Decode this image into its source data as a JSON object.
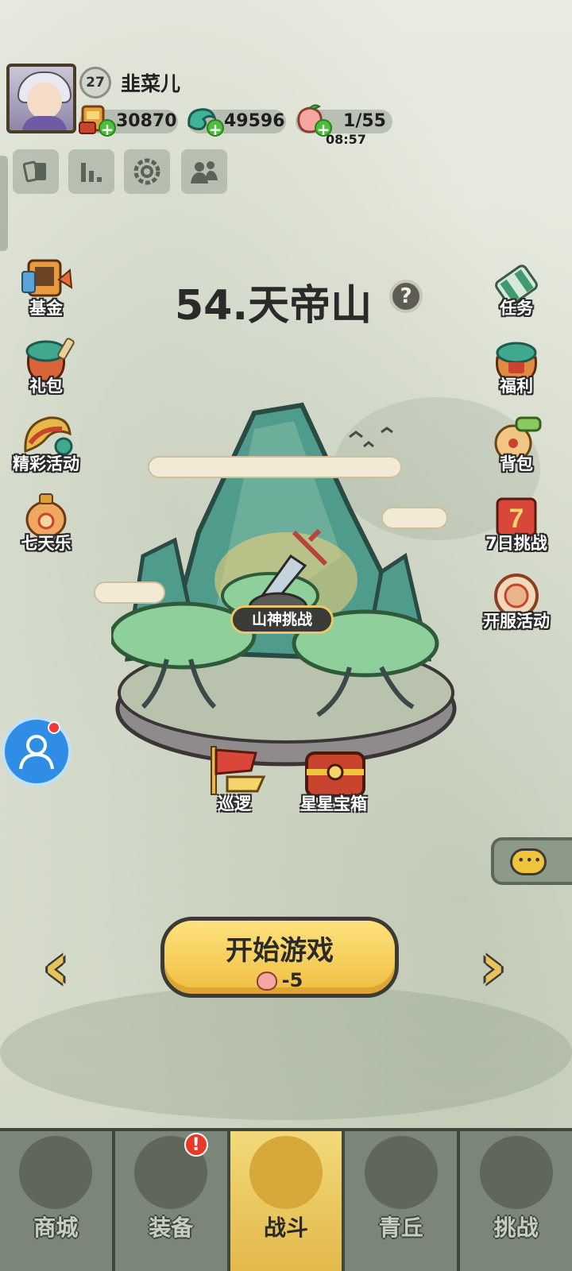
{
  "player": {
    "name": "韭菜儿",
    "level": "27"
  },
  "resources": {
    "gold": "30870",
    "gems": "49596",
    "stamina": "1/55",
    "stamina_timer": "08:57"
  },
  "toolbar": {
    "icons": [
      "card-icon",
      "stats-icon",
      "settings-icon",
      "friends-icon"
    ]
  },
  "left_menu": [
    {
      "label": "基金",
      "icon": "fund-icon"
    },
    {
      "label": "礼包",
      "icon": "gift-pack-icon"
    },
    {
      "label": "精彩活动",
      "icon": "events-icon"
    },
    {
      "label": "七天乐",
      "icon": "seven-days-icon"
    }
  ],
  "right_menu": [
    {
      "label": "任务",
      "icon": "quest-icon"
    },
    {
      "label": "福利",
      "icon": "welfare-icon"
    },
    {
      "label": "背包",
      "icon": "backpack-icon"
    },
    {
      "label": "7日挑战",
      "icon": "seven-day-challenge-icon"
    },
    {
      "label": "开服活动",
      "icon": "server-launch-icon"
    }
  ],
  "stage": {
    "title": "54.天帝山",
    "help": "?",
    "boss_label": "山神挑战",
    "patrol_label": "巡逻",
    "chest_label": "星星宝箱"
  },
  "start": {
    "label": "开始游戏",
    "cost": "-5"
  },
  "nav": {
    "items": [
      {
        "label": "商城",
        "icon": "shop-icon"
      },
      {
        "label": "装备",
        "icon": "equipment-icon",
        "alert": "!"
      },
      {
        "label": "战斗",
        "icon": "battle-icon",
        "active": true
      },
      {
        "label": "青丘",
        "icon": "qingqiu-icon"
      },
      {
        "label": "挑战",
        "icon": "challenge-icon"
      }
    ]
  },
  "colors": {
    "accent": "#f1be41",
    "nav_bg": "#7c8678",
    "plus_green": "#4bbf3a",
    "alert_red": "#e8392a"
  }
}
